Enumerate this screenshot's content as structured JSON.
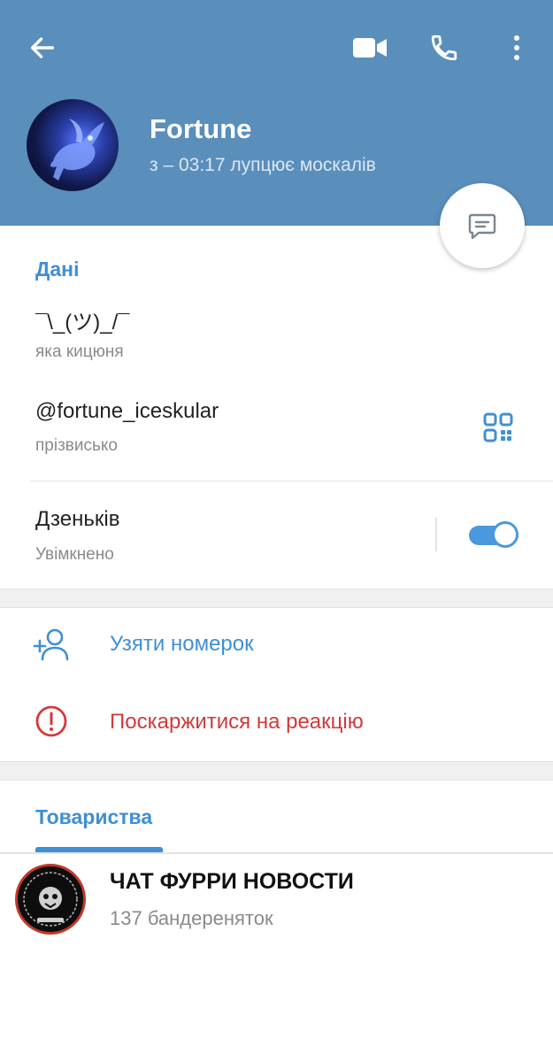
{
  "header": {
    "name": "Fortune",
    "status": "з – 03:17 лупцює москалів",
    "background_color": "#5a8ebb",
    "icons": {
      "back": "arrow-left-icon",
      "video": "video-call-icon",
      "phone": "phone-icon",
      "more": "more-vertical-icon",
      "message": "message-icon"
    }
  },
  "info": {
    "section_title": "Дані",
    "bio_value": "¯\\_(ツ)_/¯",
    "bio_label": "яка кицюня",
    "username_value": "@fortune_iceskular",
    "username_label": "прізвисько",
    "notifications_title": "Дзеньків",
    "notifications_status": "Увімкнено",
    "notifications_enabled": true
  },
  "actions": {
    "add_contact_label": "Узяти номерок",
    "report_label": "Поскаржитися на реакцію",
    "report_color": "#d03a3a",
    "accent_color": "#3f8fd4"
  },
  "groups": {
    "tab_label": "Товариства",
    "items": [
      {
        "name": "ЧАТ ФУРРИ НОВОСТИ",
        "members": "137 бандереняток"
      }
    ]
  }
}
